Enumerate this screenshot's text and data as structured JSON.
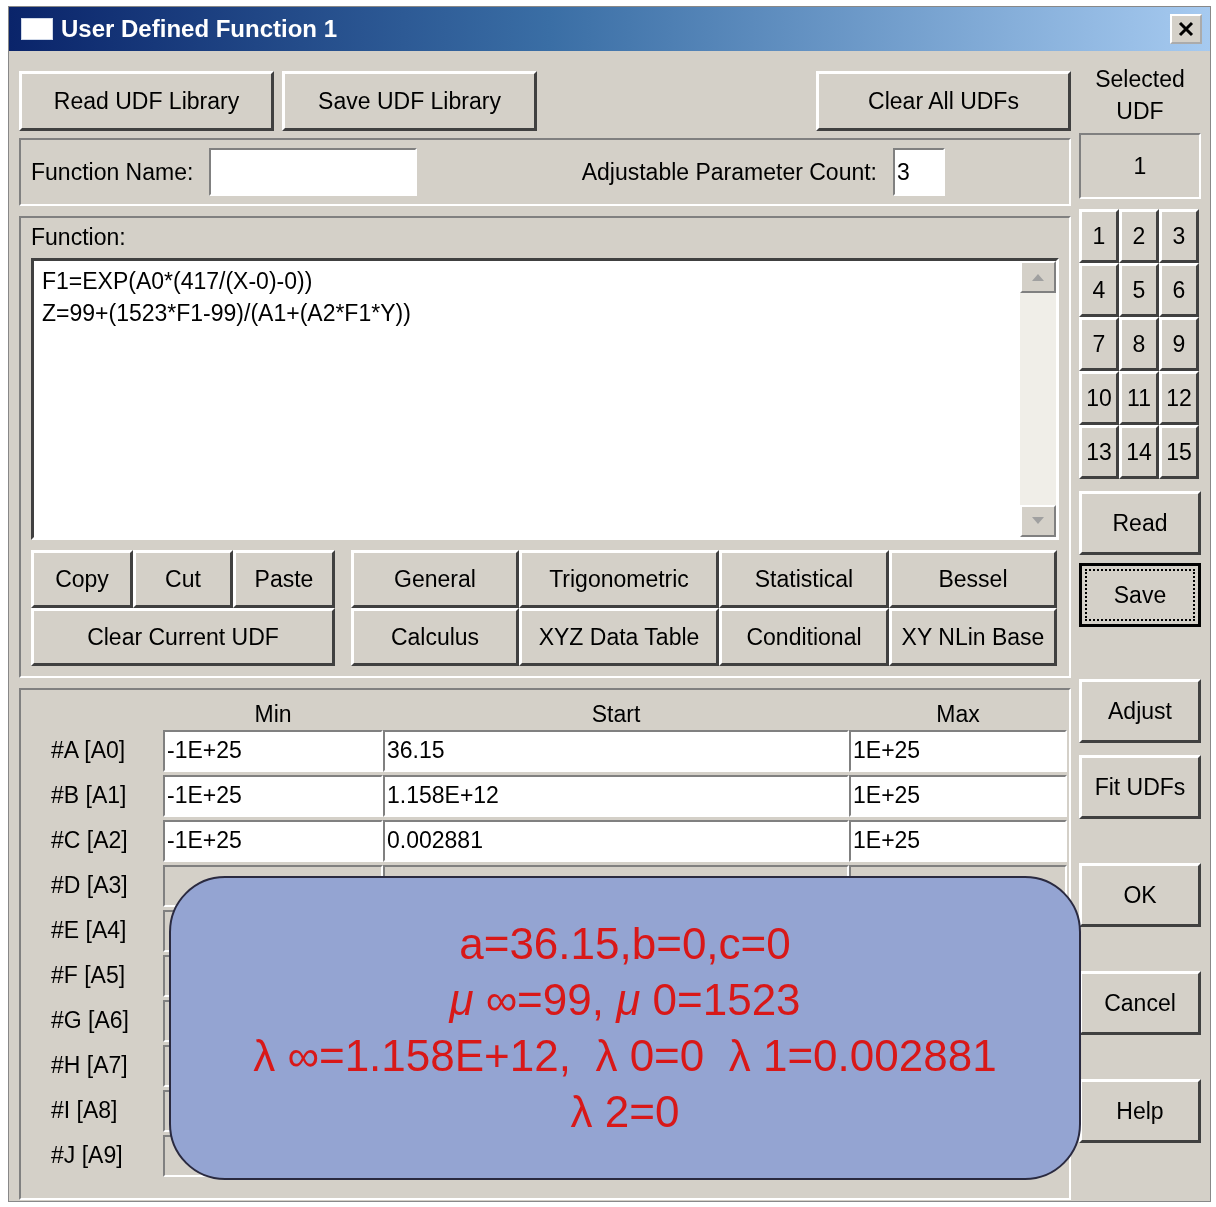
{
  "window": {
    "title": "User Defined Function 1"
  },
  "toolbar": [
    {
      "label": "Read UDF Library"
    },
    {
      "label": "Save UDF Library"
    },
    {
      "label": "Clear All UDFs"
    }
  ],
  "function_name": {
    "label": "Function Name:"
  },
  "parameter_count": {
    "label": "Adjustable Parameter Count:",
    "value": "3"
  },
  "selected_udf": {
    "label": "Selected UDF",
    "value": "1"
  },
  "udf_buttons": [
    "1",
    "2",
    "3",
    "4",
    "5",
    "6",
    "7",
    "8",
    "9",
    "10",
    "11",
    "12",
    "13",
    "14",
    "15"
  ],
  "function": {
    "label": "Function:",
    "lines": [
      "F1=EXP(A0*(417/(X-0)-0))",
      "Z=99+(1523*F1-99)/(A1+(A2*F1*Y))"
    ]
  },
  "edit_buttons": [
    "Copy",
    "Cut",
    "Paste"
  ],
  "clear_button": "Clear Current UDF",
  "category_buttons": [
    "General",
    "Trigonometric",
    "Statistical",
    "Bessel",
    "Calculus",
    "XYZ Data Table",
    "Conditional",
    "XY NLin Base"
  ],
  "udf_actions": [
    {
      "label": "Read",
      "focused": false
    },
    {
      "label": "Save",
      "focused": true
    }
  ],
  "parameters": {
    "columns": [
      "Min",
      "Start",
      "Max"
    ],
    "rows": [
      {
        "label": "#A [A0]",
        "covered": false,
        "disabled": false,
        "min": "-1E+25",
        "start": "36.15",
        "max": "1E+25"
      },
      {
        "label": "#B [A1]",
        "covered": false,
        "disabled": false,
        "min": "-1E+25",
        "start": "1.158E+12",
        "max": "1E+25"
      },
      {
        "label": "#C [A2]",
        "covered": false,
        "disabled": false,
        "min": "-1E+25",
        "start": "0.002881",
        "max": "1E+25"
      },
      {
        "label": "#D [A3]",
        "covered": false,
        "disabled": true
      },
      {
        "label": "#E [A4]",
        "covered": true,
        "disabled": true
      },
      {
        "label": "#F [A5]",
        "covered": true,
        "disabled": true
      },
      {
        "label": "#G [A6]",
        "covered": true,
        "disabled": true
      },
      {
        "label": "#H [A7]",
        "covered": true,
        "disabled": true
      },
      {
        "label": "#I [A8]",
        "covered": true,
        "disabled": true
      },
      {
        "label": "#J [A9]",
        "covered": true,
        "disabled": true
      }
    ]
  },
  "fit_buttons": [
    "Adjust",
    "Fit UDFs"
  ],
  "dialog_buttons": [
    "OK",
    "Cancel",
    "Help"
  ],
  "callout": {
    "lines": [
      "a=36.15,b=0,c=0",
      "*μ* ∞=99, *μ* 0=1523",
      "λ ∞=1.158E+12,  λ 0=0  λ 1=0.002881",
      "λ 2=0"
    ]
  }
}
